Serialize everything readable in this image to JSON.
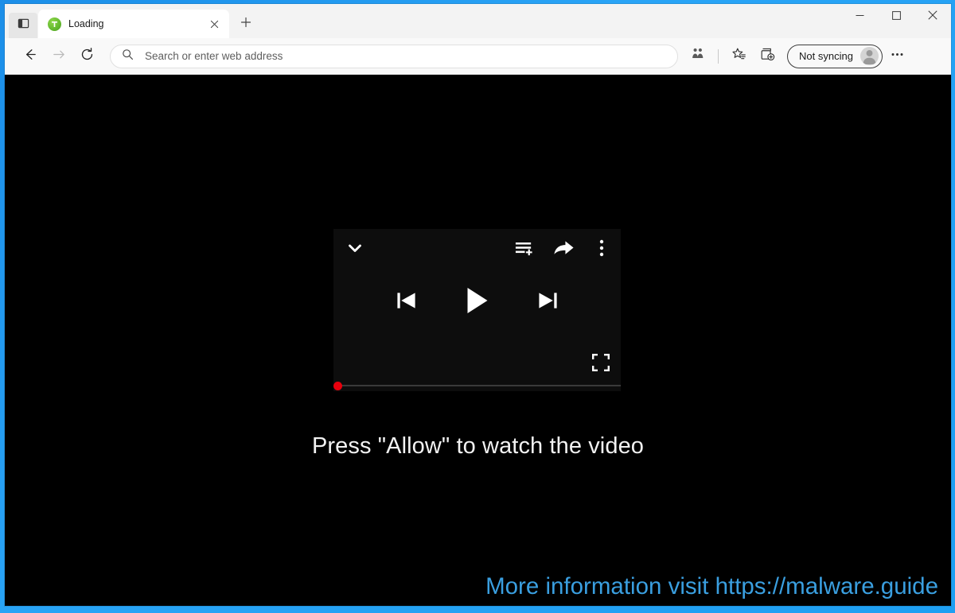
{
  "window": {
    "controls": {
      "minimize": "minimize",
      "maximize": "maximize",
      "close": "close"
    }
  },
  "tabstrip": {
    "tab_actions_label": "tab-actions",
    "tabs": [
      {
        "title": "Loading",
        "favicon": "green-circle-t-favicon",
        "close_label": "close-tab"
      }
    ],
    "new_tab_label": "new-tab"
  },
  "toolbar": {
    "back_label": "back",
    "forward_label": "forward",
    "refresh_label": "refresh",
    "address": {
      "value": "",
      "placeholder": "Search or enter web address",
      "search_icon": "search-icon"
    },
    "icons": [
      {
        "name": "math-solver-icon",
        "label": "Math solver"
      },
      {
        "name": "favorites-icon",
        "label": "Favorites"
      },
      {
        "name": "collections-icon",
        "label": "Collections"
      }
    ],
    "profile": {
      "label": "Not syncing",
      "avatar": "user-avatar"
    },
    "settings_label": "Settings and more"
  },
  "page": {
    "background_color": "#000000",
    "player": {
      "collapse_icon": "chevron-down-icon",
      "queue_icon": "add-to-queue-icon",
      "share_icon": "share-icon",
      "more_icon": "more-vertical-icon",
      "previous_icon": "previous-track-icon",
      "play_icon": "play-icon",
      "next_icon": "next-track-icon",
      "fullscreen_icon": "fullscreen-icon",
      "progress_percent": 0,
      "progress_color": "#e8000d",
      "panel_color": "#0d0d0d"
    },
    "allow_message": "Press \"Allow\" to watch the video",
    "watermark": {
      "text": "More information visit https://malware.guide",
      "color": "#3a9fe0"
    }
  },
  "theme": {
    "desktop_blue": "#1e9ff2",
    "favicon_green": "#63b92e",
    "browser_chrome": "#f3f3f3"
  }
}
